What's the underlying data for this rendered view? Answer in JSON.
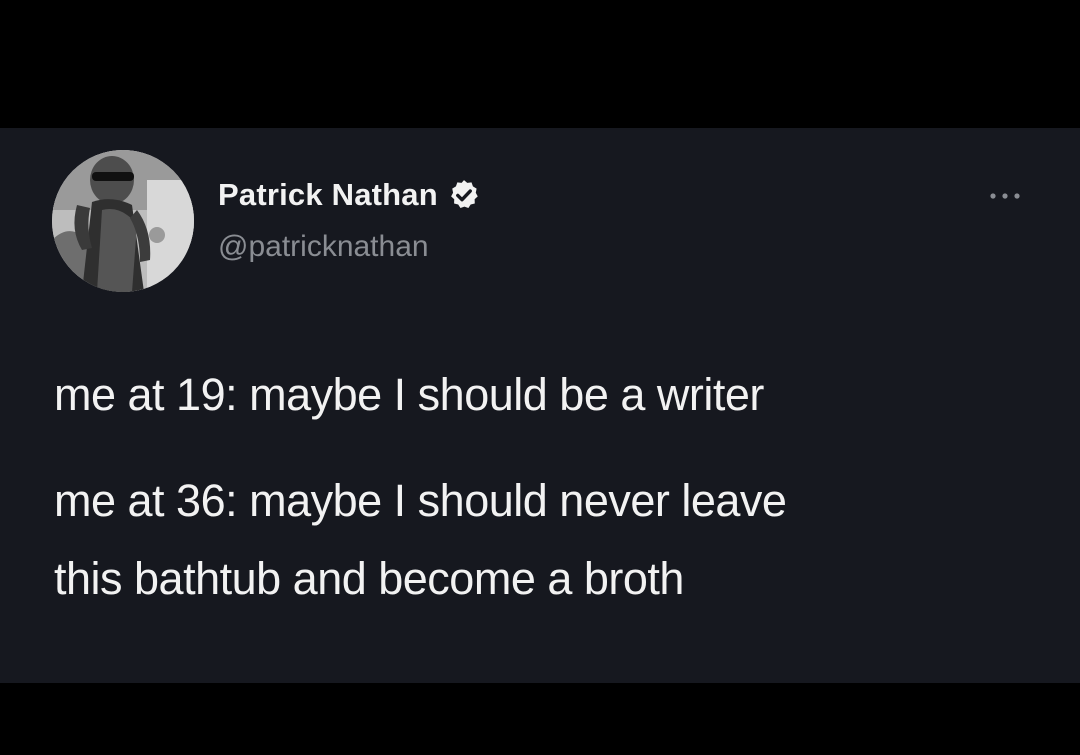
{
  "tweet": {
    "display_name": "Patrick Nathan",
    "handle": "@patricknathan",
    "verified_icon": "verified-badge-icon",
    "more_icon": "more-options-icon",
    "paragraph1": "me at 19: maybe I should be a writer",
    "paragraph2_line1": "me at 36: maybe I should never leave",
    "paragraph2_line2": "this bathtub and become a broth"
  },
  "colors": {
    "page_background": "#000000",
    "card_background": "#16181f",
    "text_primary": "#f2f2f2",
    "text_secondary": "#8a8d93"
  }
}
